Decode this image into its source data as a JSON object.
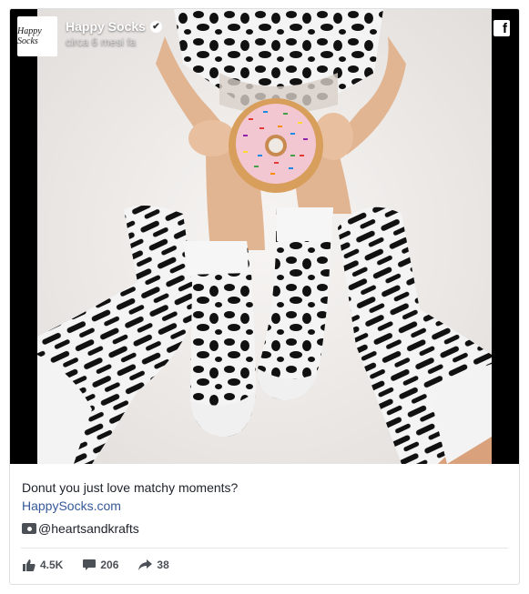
{
  "post": {
    "page_name": "Happy Socks",
    "avatar_text": "Happy Socks",
    "timestamp": "circa 6 mesi fa",
    "caption": "Donut you just love matchy moments?",
    "link_text": "HappySocks.com",
    "credit": "@heartsandkrafts"
  },
  "stats": {
    "likes": "4.5K",
    "comments": "206",
    "shares": "38"
  },
  "icons": {
    "verified": "verified-check-icon",
    "platform": "facebook-logo-icon",
    "credit": "camera-icon",
    "likes": "thumbs-up-icon",
    "comments": "comment-bubble-icon",
    "shares": "share-arrow-icon"
  },
  "colors": {
    "link": "#365899",
    "text": "#1d2129",
    "muted": "#4b4f56",
    "frame": "#000000"
  }
}
